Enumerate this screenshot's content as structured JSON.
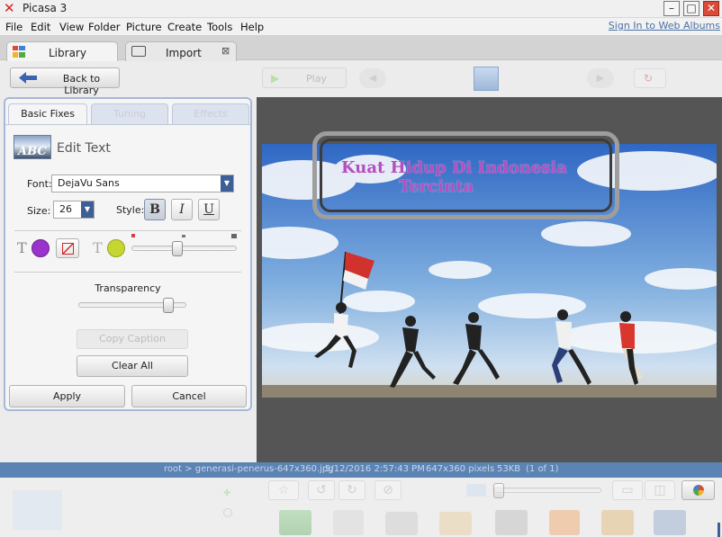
{
  "window": {
    "title": "Picasa 3",
    "logo_glyph": "✕",
    "minimize": "–",
    "maximize": "□",
    "close": "✕"
  },
  "menu": {
    "items": [
      "File",
      "Edit",
      "View",
      "Folder",
      "Picture",
      "Create",
      "Tools",
      "Help"
    ],
    "sign_in": "Sign In to Web Albums"
  },
  "tabs": {
    "library": "Library",
    "import": "Import",
    "import_close": "⊠"
  },
  "toolbar": {
    "back": "Back to Library",
    "play": "Play"
  },
  "panel": {
    "subtabs": [
      "Basic Fixes",
      "Tuning",
      "Effects"
    ],
    "edit_text_heading": "Edit Text",
    "abc_badge": "ABC",
    "font_label": "Font:",
    "font_value": "DejaVu Sans",
    "size_label": "Size:",
    "size_value": "26",
    "style_label": "Style:",
    "bold": "B",
    "italic": "I",
    "underline": "U",
    "text_glyph": "T",
    "transparency_label": "Transparency",
    "transparency": 0.87,
    "outline_width": 0.43,
    "copy_caption": "Copy Caption",
    "clear_all": "Clear All",
    "apply": "Apply",
    "cancel": "Cancel",
    "colors": {
      "text_fill": "#9933cc",
      "outline": "#c5d633",
      "accent": "#3e5f96"
    }
  },
  "photo": {
    "overlay_line1": "Kuat Hidup Di Indonesia",
    "overlay_line2": "Tercinta"
  },
  "status": {
    "path": "root > generasi-penerus-647x360.jpg",
    "datetime": "5/12/2016 2:57:43 PM",
    "dimensions": "647x360 pixels",
    "size": "53KB",
    "position": "(1 of 1)"
  }
}
